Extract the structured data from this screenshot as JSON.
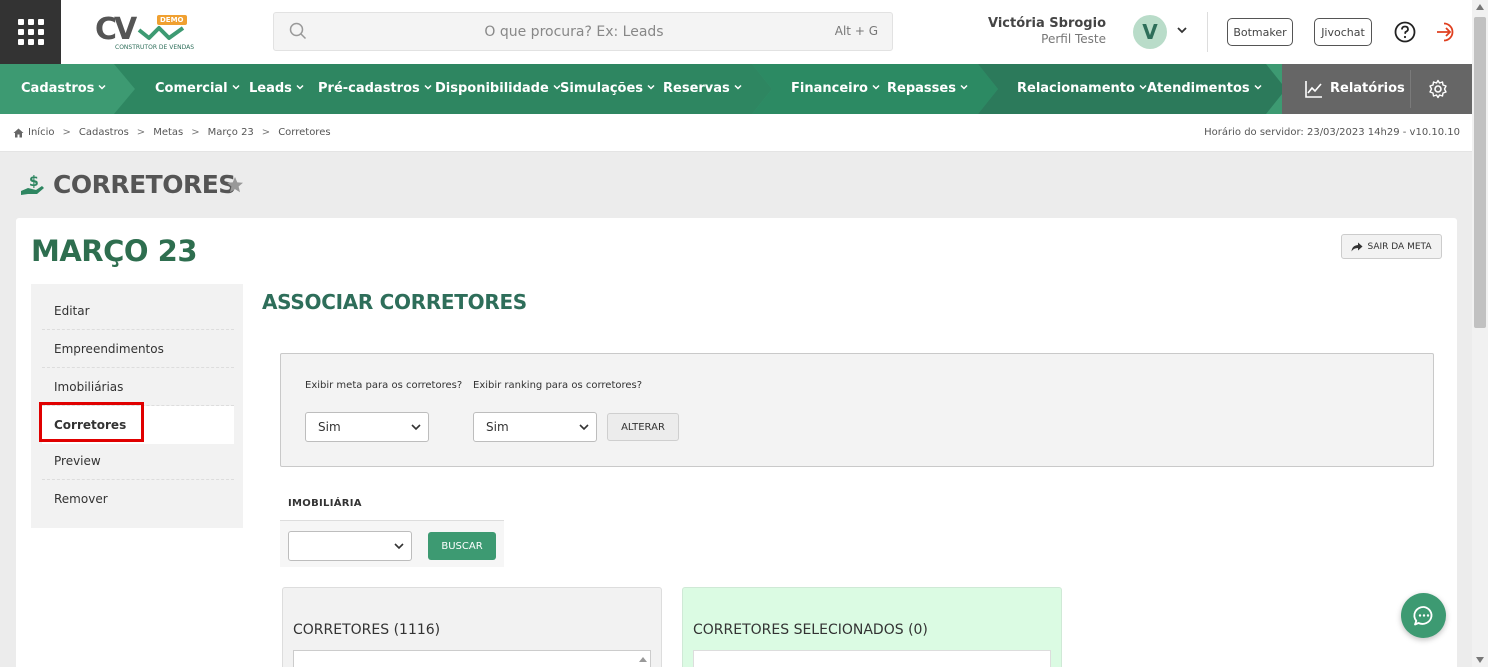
{
  "brand": {
    "logo_text": "CV",
    "demo_badge": "DEMO",
    "tagline": "CONSTRUTOR DE VENDAS"
  },
  "search": {
    "placeholder": "O que procura? Ex: Leads",
    "shortcut": "Alt + G"
  },
  "user": {
    "name": "Victória Sbrogio",
    "profile": "Perfil Teste",
    "initial": "V"
  },
  "header_buttons": {
    "botmaker": "Botmaker",
    "jivochat": "Jivochat"
  },
  "nav": {
    "items": [
      {
        "label": "Cadastros"
      },
      {
        "label": "Comercial"
      },
      {
        "label": "Leads"
      },
      {
        "label": "Pré-cadastros"
      },
      {
        "label": "Disponibilidade"
      },
      {
        "label": "Simulações"
      },
      {
        "label": "Reservas"
      },
      {
        "label": "Financeiro"
      },
      {
        "label": "Repasses"
      },
      {
        "label": "Relacionamento"
      },
      {
        "label": "Atendimentos"
      }
    ],
    "reports": "Relatórios",
    "colors": {
      "primary": "#3d9a72",
      "dark": "#2e8661",
      "darker": "#2c7a5b",
      "reports_bg": "#666666"
    }
  },
  "breadcrumb": {
    "items": [
      "Início",
      "Cadastros",
      "Metas",
      "Março 23",
      "Corretores"
    ],
    "server_time": "Horário do servidor: 23/03/2023 14h29 - v10.10.10"
  },
  "page": {
    "title": "CORRETORES",
    "meta_title": "MARÇO 23",
    "exit_button": "SAIR DA META"
  },
  "sidemenu": {
    "items": [
      {
        "label": "Editar"
      },
      {
        "label": "Empreendimentos"
      },
      {
        "label": "Imobiliárias"
      },
      {
        "label": "Corretores"
      },
      {
        "label": "Preview"
      },
      {
        "label": "Remover"
      }
    ],
    "active_index": 3
  },
  "associate": {
    "title": "ASSOCIAR CORRETORES",
    "show_goal_label": "Exibir meta para os corretores?",
    "show_goal_value": "Sim",
    "show_ranking_label": "Exibir ranking para os corretores?",
    "show_ranking_value": "Sim",
    "alter_button": "ALTERAR"
  },
  "filter": {
    "imobiliaria_label": "IMOBILIÁRIA",
    "imobiliaria_value": "",
    "search_button": "BUSCAR"
  },
  "lists": {
    "available_title": "CORRETORES (1116)",
    "selected_title": "CORRETORES SELECIONADOS (0)"
  }
}
